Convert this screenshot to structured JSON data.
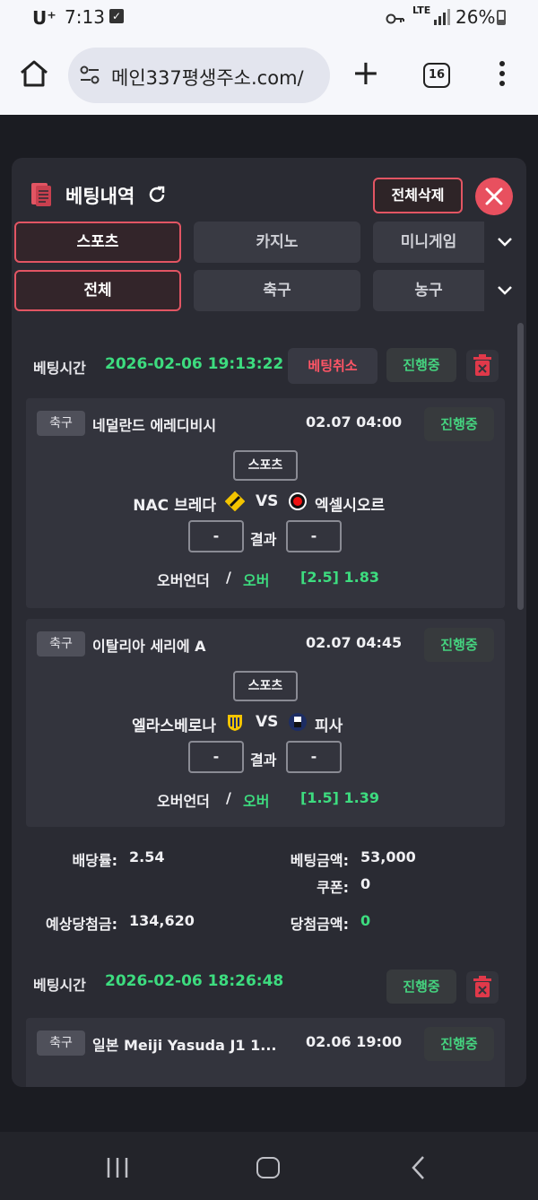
{
  "status_bar": {
    "carrier": "U⁺",
    "time": "7:13",
    "network": "LTE",
    "battery": "26%"
  },
  "browser": {
    "url": "메인337평생주소.com/",
    "tab_count": "16"
  },
  "panel": {
    "title": "베팅내역",
    "delete_all": "전체삭제"
  },
  "tabs_row1": [
    "스포츠",
    "카지노",
    "미니게임"
  ],
  "tabs_row2": [
    "전체",
    "축구",
    "농구"
  ],
  "labels": {
    "bet_time": "베팅시간",
    "cancel": "베팅취소",
    "result": "결과",
    "vs": "VS",
    "sep": "/",
    "odds_rate": "배당률:",
    "bet_amount": "베팅금액:",
    "coupon": "쿠폰:",
    "expected_win": "예상당첨금:",
    "win_amount": "당첨금액:"
  },
  "bets": [
    {
      "time": "2026-02-06 19:13:22",
      "status": "진행중",
      "matches": [
        {
          "sport": "축구",
          "league": "네덜란드 에레디비시",
          "date": "02.07 04:00",
          "status": "진행중",
          "tag": "스포츠",
          "home": "NAC 브레다",
          "away": "엑셀시오르",
          "home_score": "-",
          "away_score": "-",
          "pick_type": "오버언더",
          "pick": "오버",
          "odds": "[2.5] 1.83"
        },
        {
          "sport": "축구",
          "league": "이탈리아 세리에 A",
          "date": "02.07 04:45",
          "status": "진행중",
          "tag": "스포츠",
          "home": "엘라스베로나",
          "away": "피사",
          "home_score": "-",
          "away_score": "-",
          "pick_type": "오버언더",
          "pick": "오버",
          "odds": "[1.5] 1.39"
        }
      ],
      "summary": {
        "odds_rate": "2.54",
        "bet_amount": "53,000",
        "coupon": "0",
        "expected_win": "134,620",
        "win_amount": "0"
      }
    },
    {
      "time": "2026-02-06 18:26:48",
      "status": "진행중",
      "matches": [
        {
          "sport": "축구",
          "league": "일본 Meiji Yasuda J1 1...",
          "date": "02.06 19:00",
          "status": "진행중"
        }
      ]
    }
  ],
  "colors": {
    "accent": "#e25563",
    "green": "#3ddc7f",
    "panel": "#2a2b33"
  }
}
